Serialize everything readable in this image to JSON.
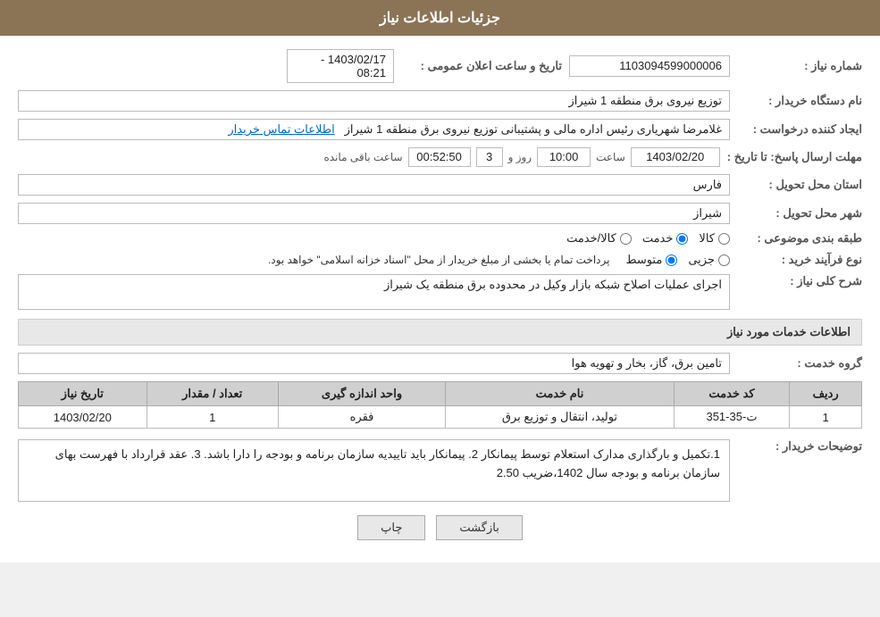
{
  "header": {
    "title": "جزئیات اطلاعات نیاز"
  },
  "fields": {
    "need_number_label": "شماره نیاز :",
    "need_number_value": "1103094599000006",
    "buyer_org_label": "نام دستگاه خریدار :",
    "buyer_org_value": "توزیع نیروی برق منطقه 1 شیراز",
    "creator_label": "ایجاد کننده درخواست :",
    "creator_value": "غلامرضا شهریاری رئیس اداره مالی و پشتیبانی  توزیع نیروی برق منطقه 1 شیراز",
    "contact_link": "اطلاعات تماس خریدار",
    "response_deadline_label": "مهلت ارسال پاسخ: تا تاریخ :",
    "response_date_value": "1403/02/20",
    "response_time_label": "ساعت",
    "response_time_value": "10:00",
    "response_days_label": "روز و",
    "response_days_value": "3",
    "remaining_time_label": "ساعت باقی مانده",
    "remaining_time_value": "00:52:50",
    "announce_label": "تاریخ و ساعت اعلان عمومی :",
    "announce_value": "1403/02/17 - 08:21",
    "province_label": "استان محل تحویل :",
    "province_value": "فارس",
    "city_label": "شهر محل تحویل :",
    "city_value": "شیراز",
    "category_label": "طبقه بندی موضوعی :",
    "category_radio1": "کالا",
    "category_radio2": "خدمت",
    "category_radio3": "کالا/خدمت",
    "purchase_type_label": "نوع فرآیند خرید :",
    "purchase_radio1": "جزیی",
    "purchase_radio2": "متوسط",
    "purchase_note": "پرداخت تمام یا بخشی از مبلغ خریدار از محل \"اسناد خزانه اسلامی\" خواهد بود.",
    "general_desc_label": "شرح کلی نیاز :",
    "general_desc_value": "اجرای عملیات اصلاح شبکه بازار وکیل در محدوده برق منطقه یک شیراز",
    "services_section_label": "اطلاعات خدمات مورد نیاز",
    "service_group_label": "گروه خدمت :",
    "service_group_value": "تامین برق، گاز، بخار و تهویه هوا",
    "table": {
      "headers": [
        "ردیف",
        "کد خدمت",
        "نام خدمت",
        "واحد اندازه گیری",
        "تعداد / مقدار",
        "تاریخ نیاز"
      ],
      "rows": [
        {
          "row_num": "1",
          "service_code": "ت-35-351",
          "service_name": "تولید، انتقال و توزیع برق",
          "unit": "فقره",
          "quantity": "1",
          "date": "1403/02/20"
        }
      ]
    },
    "buyer_desc_label": "توضیحات خریدار :",
    "buyer_desc_value": "1.تکمیل و بارگذاری مدارک استعلام توسط پیمانکار 2. پیمانکار باید تاییدیه سازمان برنامه و بودجه را دارا باشد. 3. عقد قرارداد با فهرست بهای سازمان برنامه و بودجه سال 1402،ضریب 2.50"
  },
  "buttons": {
    "back_label": "بازگشت",
    "print_label": "چاپ"
  }
}
